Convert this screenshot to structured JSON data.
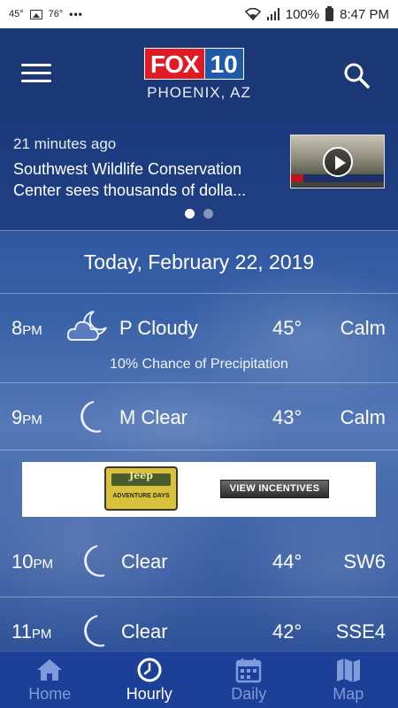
{
  "status_bar": {
    "left_temp": "45°",
    "left_temp2": "76°",
    "more": "•••",
    "battery_pct": "100%",
    "time": "8:47 PM"
  },
  "header": {
    "logo_fox": "FOX",
    "logo_number": "10",
    "city": "PHOENIX, AZ"
  },
  "news": {
    "time_ago": "21 minutes ago",
    "title": "Southwest Wildlife Conservation Center sees thousands of dolla...",
    "pager_count": 2,
    "pager_active": 0
  },
  "date_heading": "Today, February 22, 2019",
  "hourly": [
    {
      "hour": "8",
      "ampm": "PM",
      "icon": "moon-cloud-icon",
      "condition": "P Cloudy",
      "temp": "45°",
      "wind": "Calm",
      "precip": "10% Chance of Precipitation"
    },
    {
      "hour": "9",
      "ampm": "PM",
      "icon": "moon-icon",
      "condition": "M Clear",
      "temp": "43°",
      "wind": "Calm"
    },
    {
      "hour": "10",
      "ampm": "PM",
      "icon": "moon-icon",
      "condition": "Clear",
      "temp": "44°",
      "wind": "SW6"
    },
    {
      "hour": "11",
      "ampm": "PM",
      "icon": "moon-icon",
      "condition": "Clear",
      "temp": "42°",
      "wind": "SSE4"
    }
  ],
  "ad": {
    "brand": "Jeep",
    "tagline": "ADVENTURE DAYS",
    "cta": "VIEW INCENTIVES"
  },
  "nav": [
    {
      "label": "Home",
      "icon": "home-icon"
    },
    {
      "label": "Hourly",
      "icon": "clock-icon",
      "active": true
    },
    {
      "label": "Daily",
      "icon": "calendar-icon"
    },
    {
      "label": "Map",
      "icon": "map-icon"
    }
  ],
  "colors": {
    "header_bg": "#1b3775",
    "nav_bg": "#1c3f97",
    "fox_red": "#e01b24",
    "nav_inactive": "#7f9bdb"
  }
}
